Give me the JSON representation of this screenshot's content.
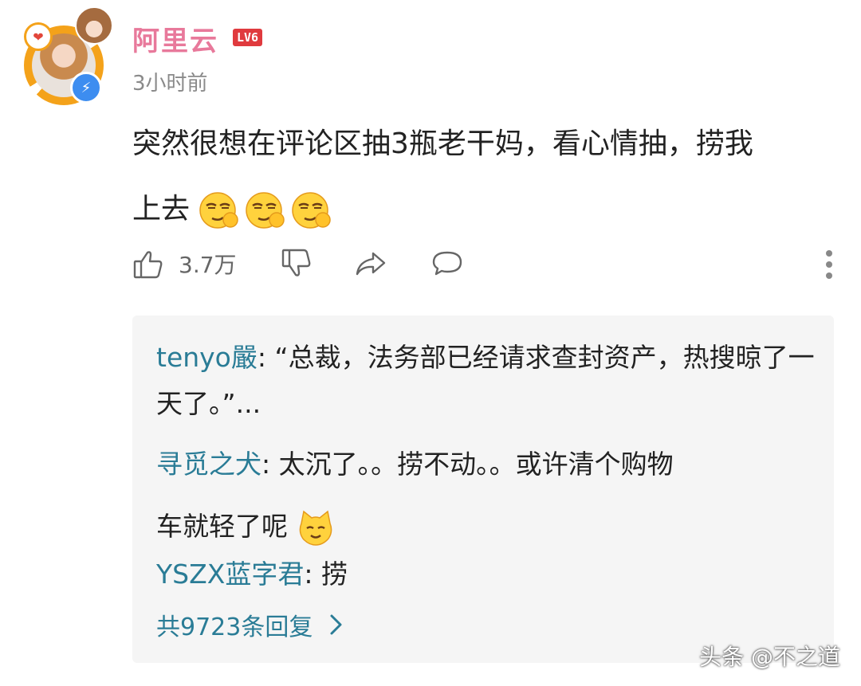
{
  "comment": {
    "username": "阿里云",
    "level_badge": "LV6",
    "time": "3小时前",
    "text_line1": "突然很想在评论区抽3瓶老干妈，看心情抽，捞我",
    "text_line2": "上去",
    "emoji_count": 3,
    "like_count": "3.7万"
  },
  "replies": [
    {
      "name": "tenyo嚴",
      "sep": ": ",
      "text": "“总裁，法务部已经请求查封资产，热搜晾了一天了。”..."
    },
    {
      "name": "寻觅之犬",
      "sep": ": ",
      "text_line1": "太沉了。。捞不动。。或许清个购物",
      "text_line2": "车就轻了呢"
    },
    {
      "name": "YSZX蓝字君",
      "sep": ": ",
      "text": "捞"
    }
  ],
  "more_replies_label": "共9723条回复",
  "watermark": "头条 @不之道",
  "colors": {
    "username": "#e8799b",
    "reply_name": "#2a7c96",
    "badge": "#e03a3e",
    "avatar_ring": "#f4a21a"
  },
  "icons": [
    "thumbs-up-icon",
    "thumbs-down-icon",
    "share-icon",
    "comment-icon",
    "more-vertical-icon",
    "chevron-right-icon"
  ]
}
